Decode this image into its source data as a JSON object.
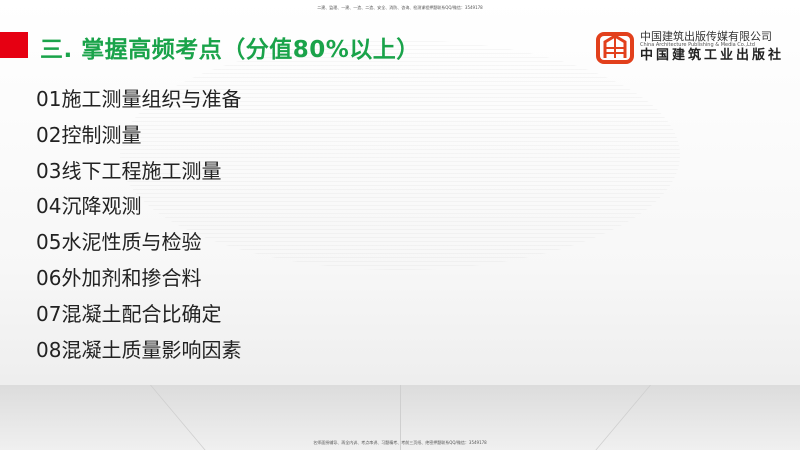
{
  "top_note": "二建、监理、一建、一造、二造、安全、消防、咨询、检测课程押题联系QQ/微信：3549178",
  "title": "三. 掌握高频考点（分值80%以上）",
  "logo": {
    "cn": "中国建筑出版传媒有限公司",
    "en": "China Architecture Publishing & Media Co.,Ltd",
    "cn2": "中国建筑工业出版社"
  },
  "items": [
    "01施工测量组织与准备",
    "02控制测量",
    "03线下工程施工测量",
    "04沉降观测",
    "05水泥性质与检验",
    "06外加剂和掺合料",
    "07混凝土配合比确定",
    "08混凝土质量影响因素"
  ],
  "bottom_note": "名师面授辅导、再全内训、考点串讲、习题精考、考前三页纸、绝密押题联系QQ/微信：3549178",
  "colors": {
    "accent_red": "#e60012",
    "title_green": "#1aa34a"
  }
}
